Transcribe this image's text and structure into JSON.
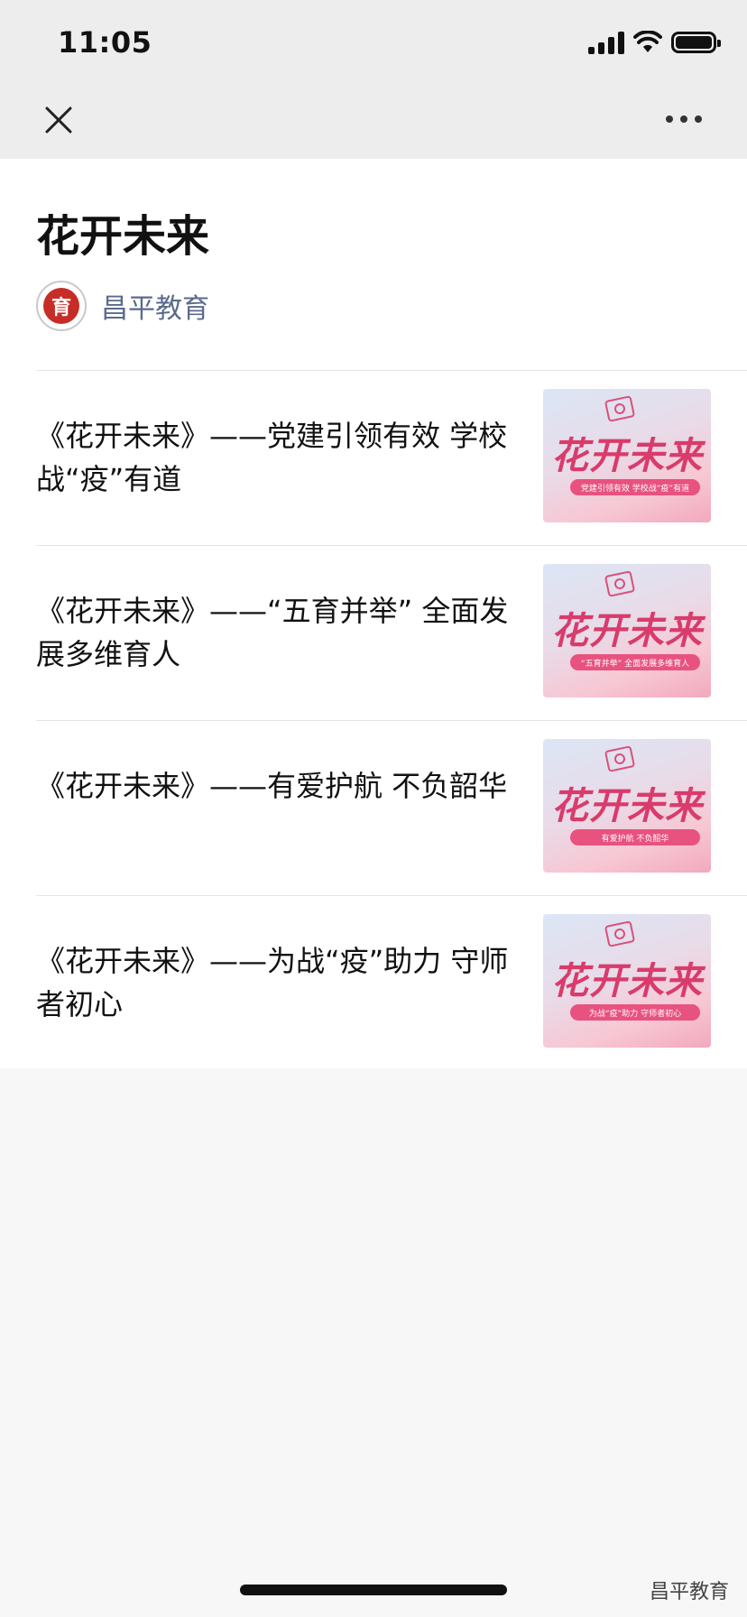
{
  "status": {
    "time": "11:05"
  },
  "nav": {
    "close_icon": "close-icon",
    "more_icon": "more-icon"
  },
  "page": {
    "title": "花开未来"
  },
  "account": {
    "name": "昌平教育",
    "avatar_text": "育"
  },
  "articles": [
    {
      "title": "《花开未来》——党建引领有效 学校战“疫”有道",
      "thumb_title": "花开未来",
      "thumb_caption": "党建引领有效 学校战“疫”有道"
    },
    {
      "title": "《花开未来》——“五育并举” 全面发展多维育人",
      "thumb_title": "花开未来",
      "thumb_caption": "“五育并举” 全面发展多维育人"
    },
    {
      "title": "《花开未来》——有爱护航 不负韶华",
      "thumb_title": "花开未来",
      "thumb_caption": "有爱护航 不负韶华"
    },
    {
      "title": "《花开未来》——为战“疫”助力 守师者初心",
      "thumb_title": "花开未来",
      "thumb_caption": "为战“疫”助力 守师者初心"
    }
  ],
  "watermark": "昌平教育",
  "colors": {
    "accent": "#d93b6b",
    "account_name": "#5b6b8c",
    "logo_red": "#c62d27"
  }
}
